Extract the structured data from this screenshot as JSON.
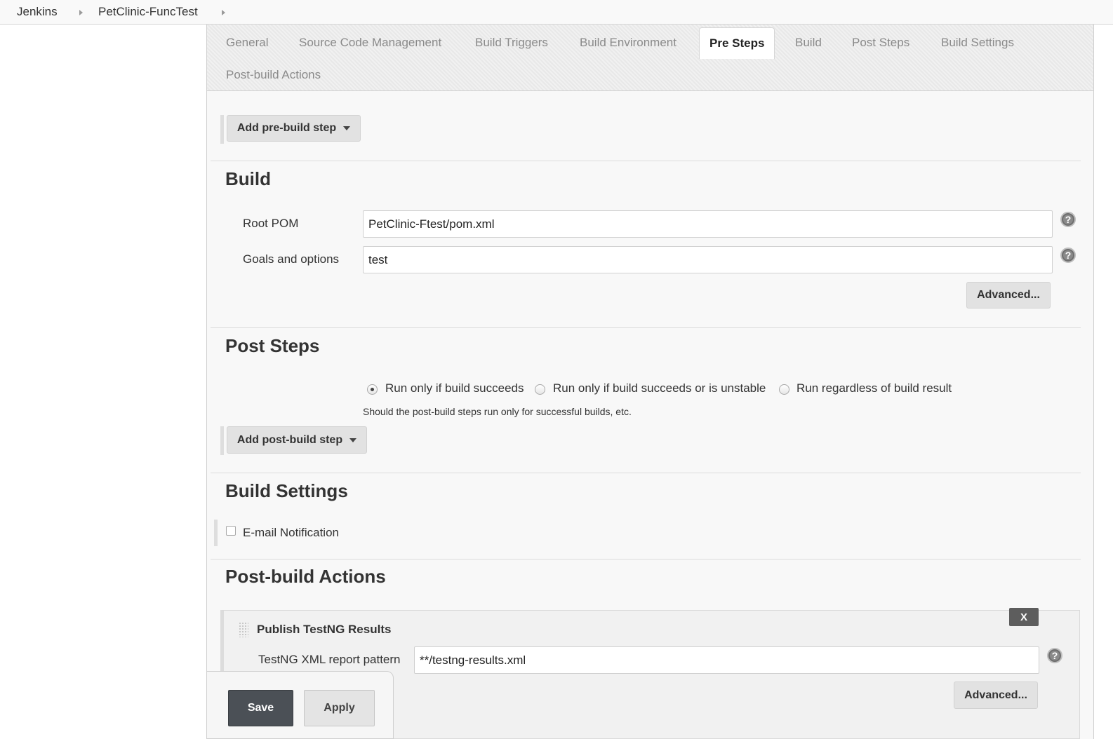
{
  "breadcrumb": {
    "items": [
      "Jenkins",
      "PetClinic-FuncTest"
    ]
  },
  "tabs": [
    {
      "label": "General",
      "active": false
    },
    {
      "label": "Source Code Management",
      "active": false
    },
    {
      "label": "Build Triggers",
      "active": false
    },
    {
      "label": "Build Environment",
      "active": false
    },
    {
      "label": "Pre Steps",
      "active": true
    },
    {
      "label": "Build",
      "active": false
    },
    {
      "label": "Post Steps",
      "active": false
    },
    {
      "label": "Build Settings",
      "active": false
    },
    {
      "label": "Post-build Actions",
      "active": false
    }
  ],
  "pre_steps": {
    "add_button": "Add pre-build step"
  },
  "build": {
    "title": "Build",
    "root_pom_label": "Root POM",
    "root_pom_value": "PetClinic-Ftest/pom.xml",
    "goals_label": "Goals and options",
    "goals_value": "test",
    "advanced_button": "Advanced...",
    "help_glyph": "?"
  },
  "post_steps": {
    "title": "Post Steps",
    "options": [
      {
        "label": "Run only if build succeeds",
        "checked": true
      },
      {
        "label": "Run only if build succeeds or is unstable",
        "checked": false
      },
      {
        "label": "Run regardless of build result",
        "checked": false
      }
    ],
    "hint": "Should the post-build steps run only for successful builds, etc.",
    "add_button": "Add post-build step"
  },
  "build_settings": {
    "title": "Build Settings",
    "email_label": "E-mail Notification",
    "email_checked": false
  },
  "post_build": {
    "title": "Post-build Actions",
    "publisher_title": "Publish TestNG Results",
    "delete_label": "X",
    "pattern_label": "TestNG XML report pattern",
    "pattern_value": "**/testng-results.xml",
    "advanced_button": "Advanced..."
  },
  "actions": {
    "save": "Save",
    "apply": "Apply"
  },
  "colors": {
    "save_button": "#4b5056",
    "panel_bg": "#f8f8f8",
    "active_tab_bg": "#ffffff"
  }
}
